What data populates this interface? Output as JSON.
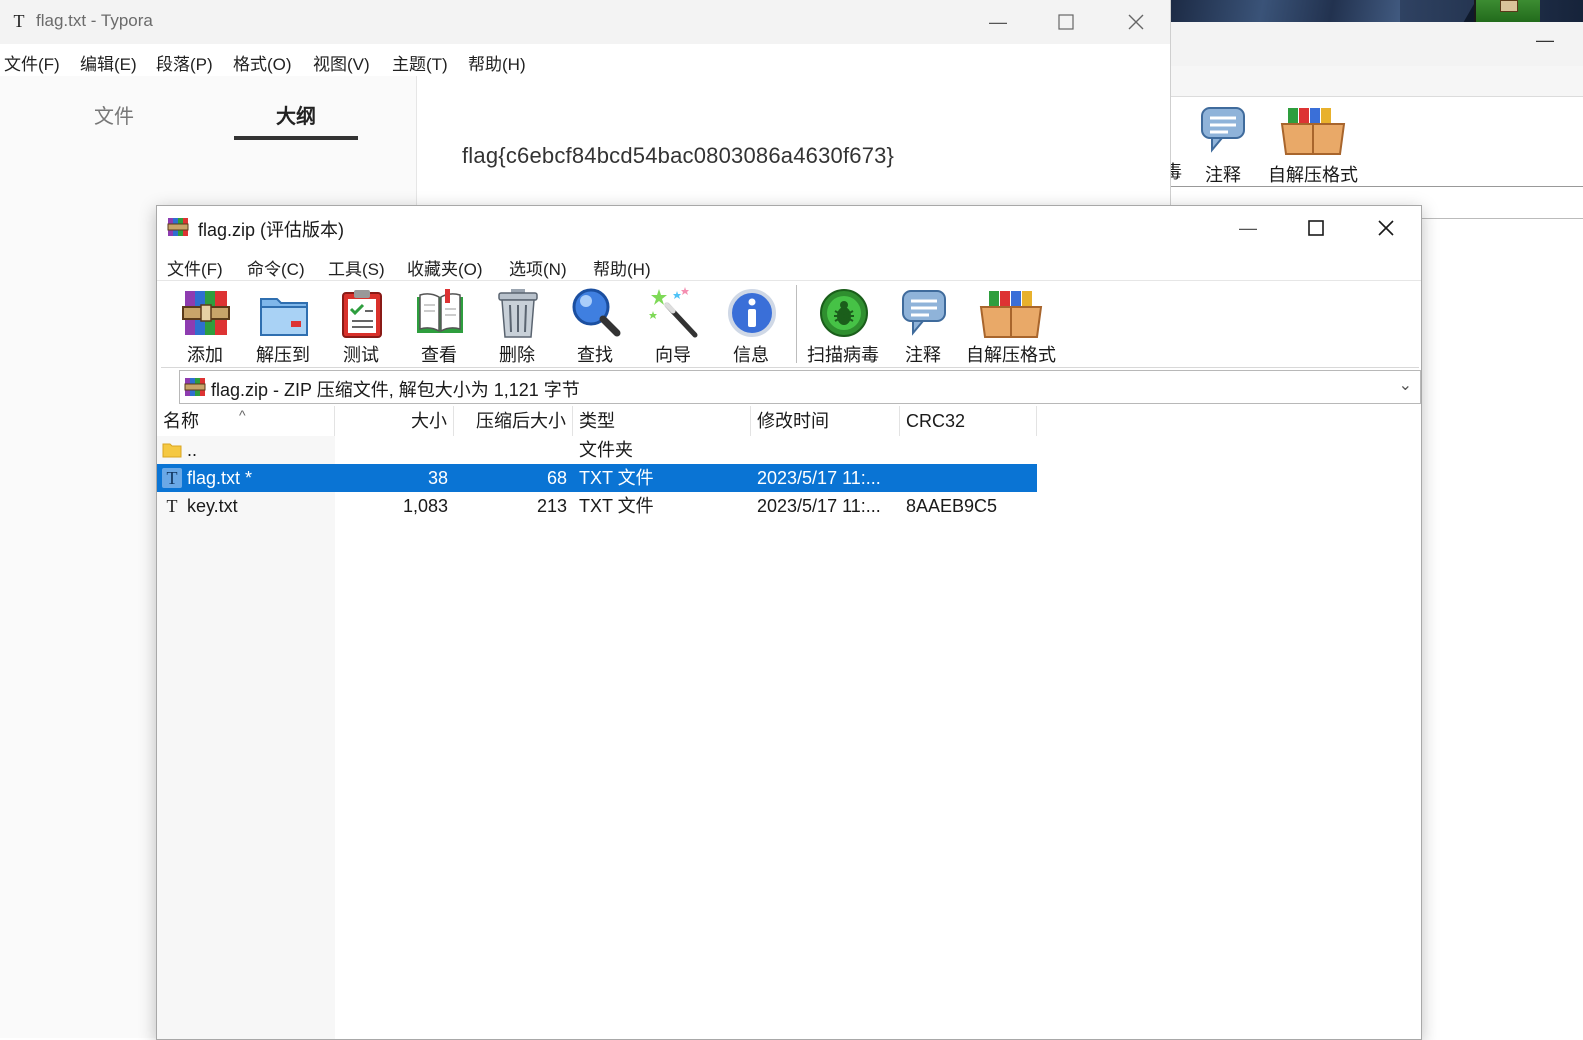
{
  "typora": {
    "title": "flag.txt - Typora",
    "app_icon_letter": "T",
    "menu": [
      "文件(F)",
      "编辑(E)",
      "段落(P)",
      "格式(O)",
      "视图(V)",
      "主题(T)",
      "帮助(H)"
    ],
    "tabs": {
      "files": "文件",
      "outline": "大纲"
    },
    "content": "flag{c6ebcf84bcd54bac0803086a4630f673}"
  },
  "back_winrar": {
    "tools": [
      "注释",
      "自解压格式"
    ],
    "partial_label": "毒"
  },
  "winrar": {
    "title": "flag.zip (评估版本)",
    "menu": [
      "文件(F)",
      "命令(C)",
      "工具(S)",
      "收藏夹(O)",
      "选项(N)",
      "帮助(H)"
    ],
    "toolbar": [
      {
        "label": "添加",
        "icon": "add-archive-icon"
      },
      {
        "label": "解压到",
        "icon": "extract-folder-icon"
      },
      {
        "label": "测试",
        "icon": "test-clipboard-icon"
      },
      {
        "label": "查看",
        "icon": "view-book-icon"
      },
      {
        "label": "删除",
        "icon": "trash-icon"
      },
      {
        "label": "查找",
        "icon": "magnifier-icon"
      },
      {
        "label": "向导",
        "icon": "wizard-wand-icon"
      },
      {
        "label": "信息",
        "icon": "info-icon"
      },
      {
        "label": "扫描病毒",
        "icon": "virus-scan-icon"
      },
      {
        "label": "注释",
        "icon": "comment-icon"
      },
      {
        "label": "自解压格式",
        "icon": "sfx-box-icon"
      }
    ],
    "address": "flag.zip - ZIP 压缩文件, 解包大小为 1,121 字节",
    "columns": {
      "name": "名称",
      "size": "大小",
      "packed": "压缩后大小",
      "type": "类型",
      "modified": "修改时间",
      "crc": "CRC32"
    },
    "rows": [
      {
        "name": "..",
        "size": "",
        "packed": "",
        "type": "文件夹",
        "modified": "",
        "crc": "",
        "icon": "folder-icon"
      },
      {
        "name": "flag.txt *",
        "size": "38",
        "packed": "68",
        "type": "TXT 文件",
        "modified": "2023/5/17 11:...",
        "crc": "",
        "icon": "text-file-icon"
      },
      {
        "name": "key.txt",
        "size": "1,083",
        "packed": "213",
        "type": "TXT 文件",
        "modified": "2023/5/17 11:...",
        "crc": "8AAEB9C5",
        "icon": "text-file-icon"
      }
    ]
  },
  "colors": {
    "selection": "#0a74d4",
    "titlebar": "#f3f3f3"
  }
}
